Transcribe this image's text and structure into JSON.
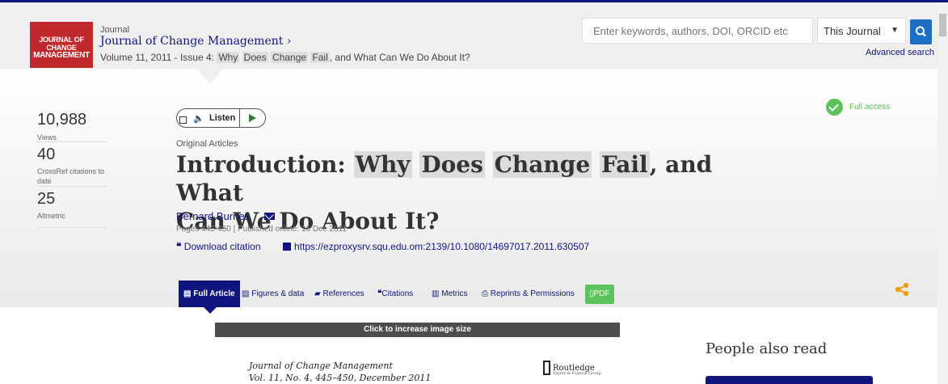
{
  "header": {
    "journal_kicker": "Journal",
    "journal_title": "Journal of Change Management ›",
    "cover_line1": "JOURNAL OF CHANGE",
    "cover_line2": "MANAGEMENT",
    "issue_prefix": "Volume 11, 2011 - Issue 4:",
    "issue_words": [
      "Why",
      "Does",
      "Change",
      "Fail"
    ],
    "issue_suffix": ", and What Can We Do About It?"
  },
  "search": {
    "placeholder": "Enter keywords, authors, DOI, ORCID etc",
    "scope_selected": "This Journal",
    "button_icon": "search-icon",
    "advanced_label": "Advanced search"
  },
  "metrics": [
    {
      "value": "10,988",
      "label": "Views"
    },
    {
      "value": "40",
      "label": "CrossRef citations to date"
    },
    {
      "value": "25",
      "label": "Altmetric"
    }
  ],
  "listen": {
    "label": "Listen"
  },
  "access": {
    "label": "Full access",
    "color": "#5cc35c"
  },
  "article": {
    "type": "Original Articles",
    "title_prefix": "Introduction:",
    "title_words": [
      "Why",
      "Does",
      "Change",
      "Fail"
    ],
    "title_suffix": ", and What",
    "title_line2": "Can We Do About It?",
    "author": "Bernard Burnes",
    "pages": "Pages 445-450 | Published online: 16 Dec 2011",
    "download_citation": "Download citation",
    "doi_link": "https://ezproxysrv.squ.edu.om:2139/10.1080/14697017.2011.630507"
  },
  "tabs": [
    {
      "label": "Full Article",
      "icon": "document-icon"
    },
    {
      "label": "Figures & data",
      "icon": "image-icon"
    },
    {
      "label": "References",
      "icon": "book-icon"
    },
    {
      "label": "Citations",
      "icon": "quote-icon"
    },
    {
      "label": "Metrics",
      "icon": "bar-chart-icon"
    },
    {
      "label": "Reprints & Permissions",
      "icon": "print-icon"
    },
    {
      "label": "PDF",
      "icon": "pdf-icon"
    }
  ],
  "viewer": {
    "bar_label": "Click to increase image size",
    "scan_journal": "Journal of Change Management",
    "scan_volume": "Vol. 11, No. 4, 445–450, December 2011",
    "publisher": "Routledge",
    "publisher_sub": "Taylor & Francis Group"
  },
  "sidebar": {
    "people_also_read": "People also read"
  },
  "colors": {
    "brand_navy": "#10147e",
    "accent_green": "#5cc35c",
    "share_orange": "#f39c12",
    "cover_red": "#c0282d"
  }
}
